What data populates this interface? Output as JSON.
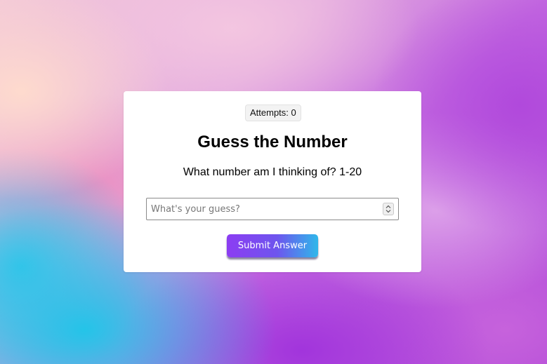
{
  "game": {
    "attempts_label": "Attempts: 0",
    "title": "Guess the Number",
    "prompt": "What number am I thinking of? 1-20",
    "guess_input": {
      "value": "",
      "placeholder": "What's your guess?"
    },
    "submit_label": "Submit Answer"
  },
  "colors": {
    "button_gradient_start": "#8c3df2",
    "button_gradient_end": "#2fb7ea",
    "card_background": "#ffffff"
  },
  "icons": {
    "spinner": "spin-up-down-icon"
  }
}
